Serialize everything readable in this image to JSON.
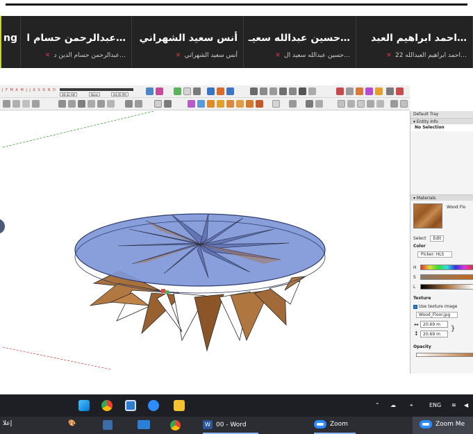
{
  "participants": [
    {
      "name": "…احمد ابراهيم العبد",
      "sub": "…احمد ابراهيم العبدالله 22"
    },
    {
      "name": "…حسين عبدالله سعيـ",
      "sub": "…حسين عبدالله سعيد ال"
    },
    {
      "name": "أنس سعيد الشهراني",
      "sub": "أنس سعيد الشهراني"
    },
    {
      "name": "…عبدالرحمن حسام ا",
      "sub": "…عبدالرحمن حسام الدين د"
    },
    {
      "name": "ng",
      "sub": ""
    }
  ],
  "sketchup": {
    "shadow_months": "J F M A M J J A S O N D",
    "time_left": "06:42 AM",
    "time_mid": "Noon",
    "time_right": "04:45 PM"
  },
  "tray": {
    "title": "Default Tray",
    "entity_info": "Entity Info",
    "no_selection": "No Selection",
    "materials": "Materials",
    "material_name": "Wood Flo",
    "select_tab": "Select",
    "edit_tab": "Edit",
    "color_label": "Color",
    "picker_label": "Picker: HLS",
    "h_label": "H",
    "s_label": "S",
    "l_label": "L",
    "texture_label": "Texture",
    "use_texture": "Use texture image",
    "texture_file": "Wood_Floor.jpg",
    "dim_w": "20.69 m",
    "dim_h": "20.69 m",
    "opacity_label": "Opacity"
  },
  "taskbar": {
    "lang": "ENG",
    "items": {
      "word": "00 - Word",
      "zoom1": "Zoom",
      "zoom2": "Zoom Me",
      "left": "إعلا"
    }
  },
  "colors": {
    "disc": "#7f97d8",
    "wood": "#a8703d",
    "taskbar": "#1d1f24",
    "zoom_blue": "#2d8cff"
  }
}
